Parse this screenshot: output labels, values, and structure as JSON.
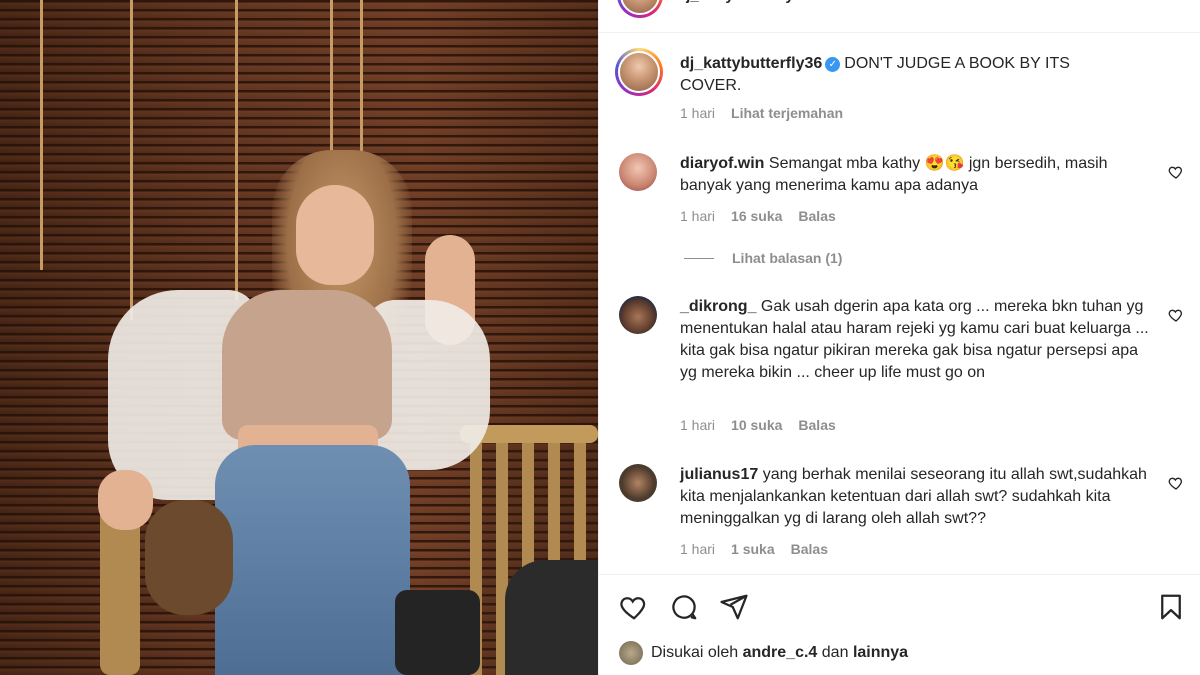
{
  "post": {
    "username": "dj_kattybutterfly36",
    "caption": "DON'T JUDGE A BOOK BY ITS COVER.",
    "time": "1 hari",
    "translate_label": "Lihat terjemahan"
  },
  "comments": [
    {
      "username": "diaryof.win",
      "text": "Semangat mba kathy 😍😘 jgn bersedih, masih banyak yang menerima kamu apa adanya",
      "time": "1 hari",
      "likes": "16 suka",
      "reply_label": "Balas"
    },
    {
      "username": "_dikrong_",
      "text": "Gak usah dgerin apa kata org ... mereka bkn tuhan yg menentukan halal atau haram rejeki yg kamu cari buat keluarga ... kita gak bisa ngatur pikiran mereka gak bisa ngatur persepsi apa yg mereka bikin ... cheer up life must go on",
      "time": "1 hari",
      "likes": "10 suka",
      "reply_label": "Balas"
    },
    {
      "username": "julianus17",
      "text": "yang berhak menilai seseorang itu allah swt,sudahkah kita menjalankankan ketentuan dari allah swt? sudahkah kita meninggalkan yg di larang oleh allah swt??",
      "time": "1 hari",
      "likes": "1 suka",
      "reply_label": "Balas"
    }
  ],
  "view_replies": "Lihat balasan (1)",
  "liked_by": {
    "prefix": "Disukai oleh",
    "user": "andre_c.4",
    "conj": "dan",
    "others": "lainnya"
  },
  "icons": [
    "heart-icon",
    "comment-icon",
    "share-icon",
    "bookmark-icon",
    "verified-icon"
  ]
}
